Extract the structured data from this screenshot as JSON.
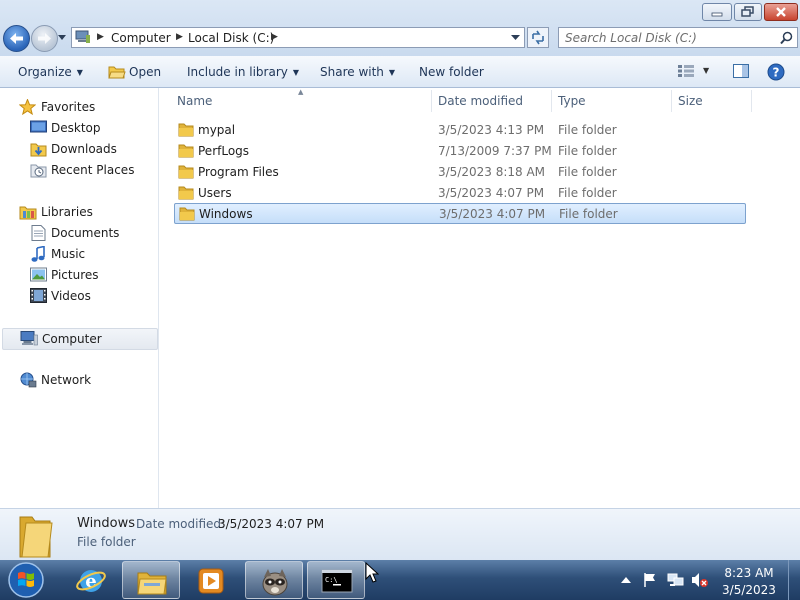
{
  "address": {
    "crumbs": [
      "Computer",
      "Local Disk (C:)"
    ]
  },
  "search": {
    "placeholder": "Search Local Disk (C:)"
  },
  "toolbar": {
    "organize": "Organize",
    "open": "Open",
    "include_in_library": "Include in library",
    "share_with": "Share with",
    "new_folder": "New folder"
  },
  "nav": {
    "favorites": "Favorites",
    "desktop": "Desktop",
    "downloads": "Downloads",
    "recent_places": "Recent Places",
    "libraries": "Libraries",
    "documents": "Documents",
    "music": "Music",
    "pictures": "Pictures",
    "videos": "Videos",
    "computer": "Computer",
    "network": "Network"
  },
  "columns": {
    "name": "Name",
    "date_modified": "Date modified",
    "type": "Type",
    "size": "Size"
  },
  "files": [
    {
      "name": "mypal",
      "date": "3/5/2023 4:13 PM",
      "type": "File folder"
    },
    {
      "name": "PerfLogs",
      "date": "7/13/2009 7:37 PM",
      "type": "File folder"
    },
    {
      "name": "Program Files",
      "date": "3/5/2023 8:18 AM",
      "type": "File folder"
    },
    {
      "name": "Users",
      "date": "3/5/2023 4:07 PM",
      "type": "File folder"
    },
    {
      "name": "Windows",
      "date": "3/5/2023 4:07 PM",
      "type": "File folder"
    }
  ],
  "selected_file": "Windows",
  "details": {
    "name": "Windows",
    "date_label": "Date modified:",
    "date_value": "3/5/2023 4:07 PM",
    "type": "File folder"
  },
  "clock": {
    "time": "8:23 AM",
    "date": "3/5/2023"
  },
  "colors": {
    "accent": "#3a6ea5",
    "selection_fill": "#cce2fb",
    "selection_border": "#7da2ce",
    "folder_yellow": "#f2c94c"
  },
  "icons": {
    "back": "back-arrow-icon",
    "forward": "forward-arrow-icon",
    "search": "search-icon",
    "folder": "folder-icon",
    "refresh": "refresh-icon"
  }
}
